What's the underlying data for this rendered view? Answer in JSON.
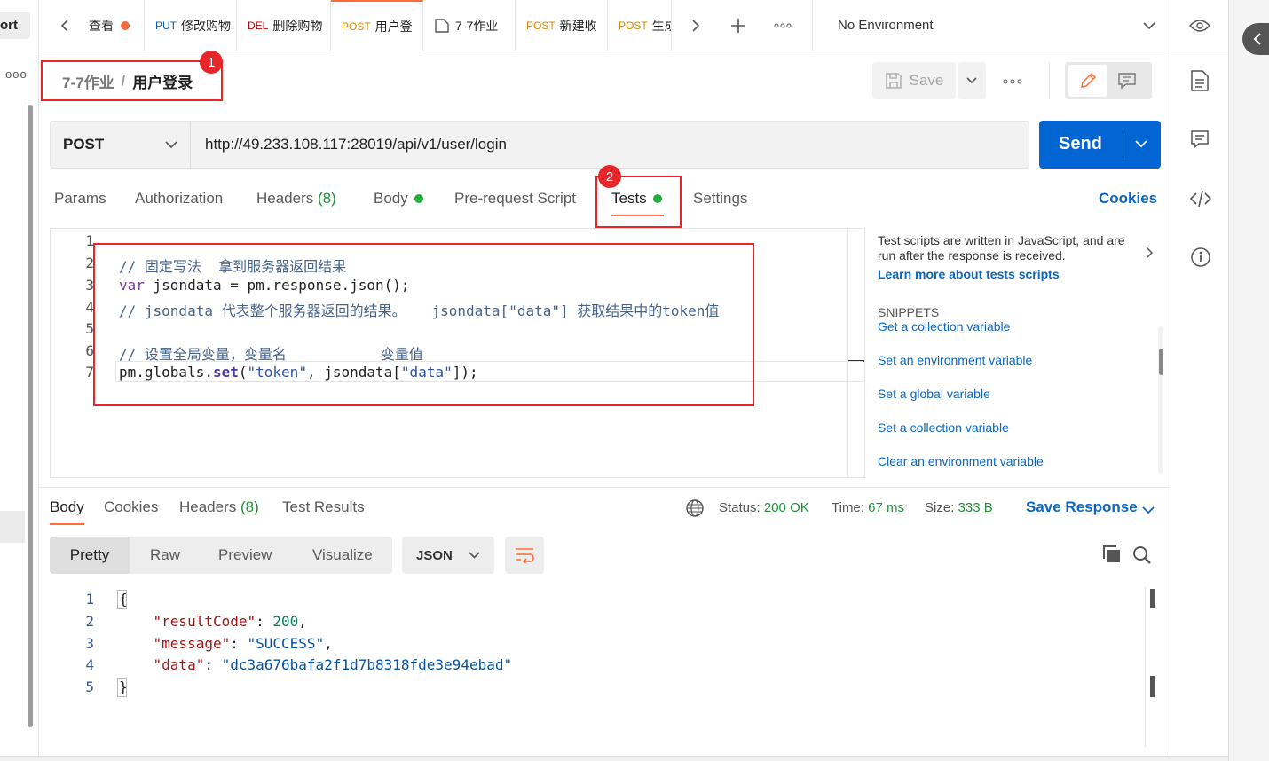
{
  "sidebar": {
    "import_label": "ort",
    "more_label": "ooo"
  },
  "tabs": [
    {
      "method": "",
      "label": "查看",
      "dot": true
    },
    {
      "method": "PUT",
      "label": "修改购物"
    },
    {
      "method": "DEL",
      "label": "删除购物"
    },
    {
      "method": "POST",
      "label": "用户登"
    },
    {
      "method": "",
      "label": "7-7作业"
    },
    {
      "method": "POST",
      "label": "新建收"
    },
    {
      "method": "POST",
      "label": "生成"
    }
  ],
  "environment": "No Environment",
  "breadcrumb": {
    "collection": "7-7作业",
    "separator": "/",
    "request": "用户登录",
    "badge": "1"
  },
  "toolbar": {
    "save_label": "Save"
  },
  "request": {
    "method": "POST",
    "url": "http://49.233.108.117:28019/api/v1/user/login",
    "send_label": "Send"
  },
  "request_tabs": {
    "params": "Params",
    "authorization": "Authorization",
    "headers": "Headers",
    "headers_count": "(8)",
    "body": "Body",
    "pre_request": "Pre-request Script",
    "tests": "Tests",
    "tests_badge": "2",
    "settings": "Settings",
    "cookies": "Cookies"
  },
  "editor": {
    "line_numbers": [
      "1",
      "2",
      "3",
      "4",
      "5",
      "6",
      "7"
    ],
    "line2": "// 固定写法  拿到服务器返回结果",
    "line3_kw": "var",
    "line3_rest": " jsondata = pm.response.json();",
    "line4": "// jsondata 代表整个服务器返回的结果。   jsondata[\"data\"] 获取结果中的token值",
    "line6": "// 设置全局变量，变量名           变量值",
    "line7_a": "pm.globals.",
    "line7_fn": "set",
    "line7_b": "(",
    "line7_s1": "\"token\"",
    "line7_c": ", jsondata[",
    "line7_s2": "\"data\"",
    "line7_d": "]);"
  },
  "snippets": {
    "intro": "Test scripts are written in JavaScript, and are run after the response is received.",
    "learn_more": "Learn more about tests scripts",
    "heading": "SNIPPETS",
    "items": [
      "Get a collection variable",
      "Set an environment variable",
      "Set a global variable",
      "Set a collection variable",
      "Clear an environment variable"
    ]
  },
  "response_tabs": {
    "body": "Body",
    "cookies": "Cookies",
    "headers": "Headers",
    "headers_count": "(8)",
    "test_results": "Test Results"
  },
  "response_meta": {
    "status_label": "Status:",
    "status_value": "200 OK",
    "time_label": "Time:",
    "time_value": "67 ms",
    "size_label": "Size:",
    "size_value": "333 B",
    "save_response": "Save Response"
  },
  "format": {
    "pretty": "Pretty",
    "raw": "Raw",
    "preview": "Preview",
    "visualize": "Visualize",
    "type": "JSON"
  },
  "response_body": {
    "line_numbers": [
      "1",
      "2",
      "3",
      "4",
      "5"
    ],
    "open": "{",
    "k1": "\"resultCode\"",
    "v1": "200",
    "k2": "\"message\"",
    "v2": "\"SUCCESS\"",
    "k3": "\"data\"",
    "v3": "\"dc3a676bafa2f1d7b8318fde3e94ebad\"",
    "close": "}"
  },
  "colors": {
    "accent": "#ff6c37",
    "send": "#0265d2",
    "highlight": "#e8262a",
    "ok": "#1eac3d"
  }
}
